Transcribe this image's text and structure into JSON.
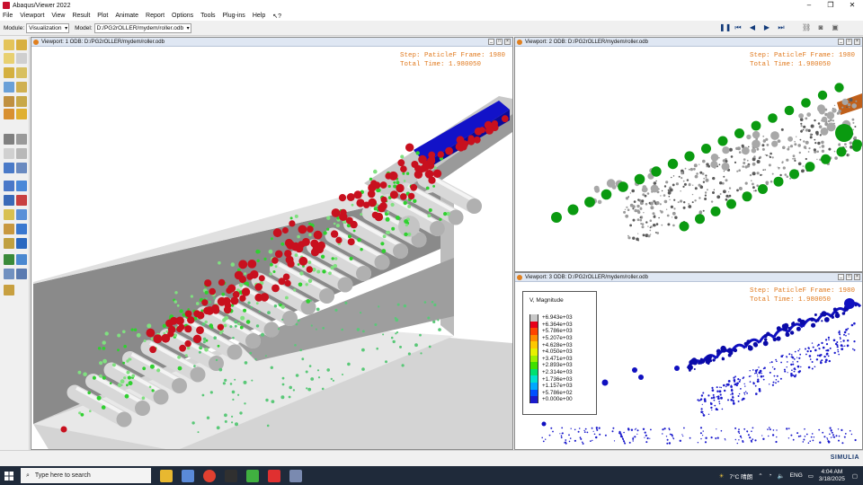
{
  "app": {
    "title": "Abaqus/Viewer 2022",
    "window_buttons": [
      "–",
      "❐",
      "✕"
    ]
  },
  "menu": [
    "File",
    "Viewport",
    "View",
    "Result",
    "Plot",
    "Animate",
    "Report",
    "Options",
    "Tools",
    "Plug-ins",
    "Help"
  ],
  "toolbar": {
    "module_label": "Module:",
    "module_value": "Visualization",
    "model_label": "Model:",
    "model_value": "D:/PG2rOLLER/mydem/roller.odb"
  },
  "viewports": {
    "vp1": {
      "title": "Viewport: 1   ODB: D:/PG2rOLLER/mydem/roller.odb",
      "step_line": "Step: PaticleF Frame: 1980",
      "time_line": "Total Time: 1.980050"
    },
    "vp2": {
      "title": "Viewport: 2   ODB: D:/PG2rOLLER/mydem/roller.odb",
      "step_line": "Step: PaticleF Frame: 1980",
      "time_line": "Total Time: 1.980050"
    },
    "vp3": {
      "title": "Viewport: 3   ODB: D:/PG2rOLLER/mydem/roller.odb",
      "step_line": "Step: PaticleF Frame: 1980",
      "time_line": "Total Time: 1.980050",
      "legend": {
        "title": "V, Magnitude",
        "values": [
          "+6.943e+03",
          "+6.364e+03",
          "+5.786e+03",
          "+5.207e+03",
          "+4.628e+03",
          "+4.050e+03",
          "+3.471e+03",
          "+2.893e+03",
          "+2.314e+03",
          "+1.736e+03",
          "+1.157e+03",
          "+5.786e+02",
          "+0.000e+00"
        ],
        "colors": [
          "#c8c8c8",
          "#e8001a",
          "#ff4400",
          "#ff8c00",
          "#ffc800",
          "#e8f000",
          "#9ef000",
          "#40e000",
          "#00e070",
          "#00e0d0",
          "#00a8ff",
          "#0050ff",
          "#1a1acc"
        ]
      }
    }
  },
  "status": {
    "brand": "SIMULIA"
  },
  "taskbar": {
    "search_placeholder": "Type here to search",
    "weather": "7°C  晴朗",
    "lang": "ENG",
    "time": "4:04 AM",
    "date": "3/18/2025"
  }
}
